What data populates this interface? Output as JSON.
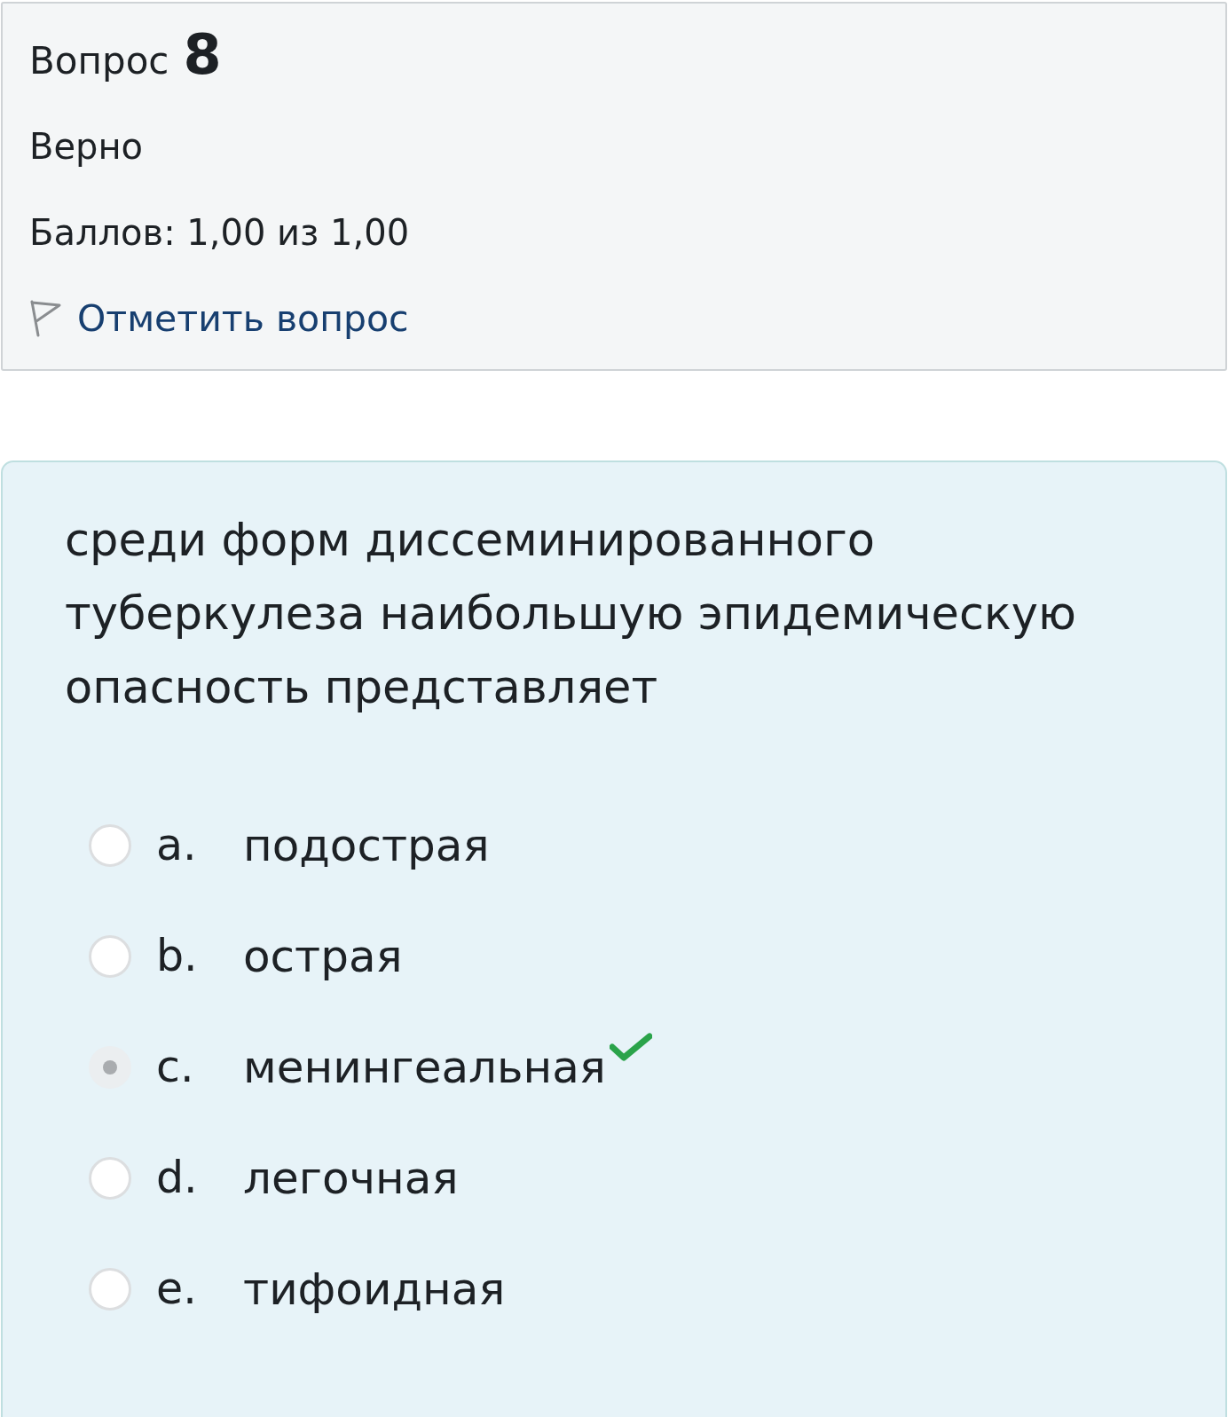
{
  "question_info": {
    "label": "Вопрос",
    "number": "8",
    "state": "Верно",
    "grade": "Баллов: 1,00 из 1,00",
    "flag_link": "Отметить вопрос"
  },
  "question": {
    "text": "среди форм диссеминированного туберкулеза наибольшую эпидемическую опасность представляет",
    "options": [
      {
        "letter": "a.",
        "text": "подострая",
        "selected": false,
        "correct": false
      },
      {
        "letter": "b.",
        "text": "острая",
        "selected": false,
        "correct": false
      },
      {
        "letter": "c.",
        "text": "менингеальная",
        "selected": true,
        "correct": true
      },
      {
        "letter": "d.",
        "text": "легочная",
        "selected": false,
        "correct": false
      },
      {
        "letter": "e.",
        "text": "тифоидная",
        "selected": false,
        "correct": false
      }
    ]
  }
}
